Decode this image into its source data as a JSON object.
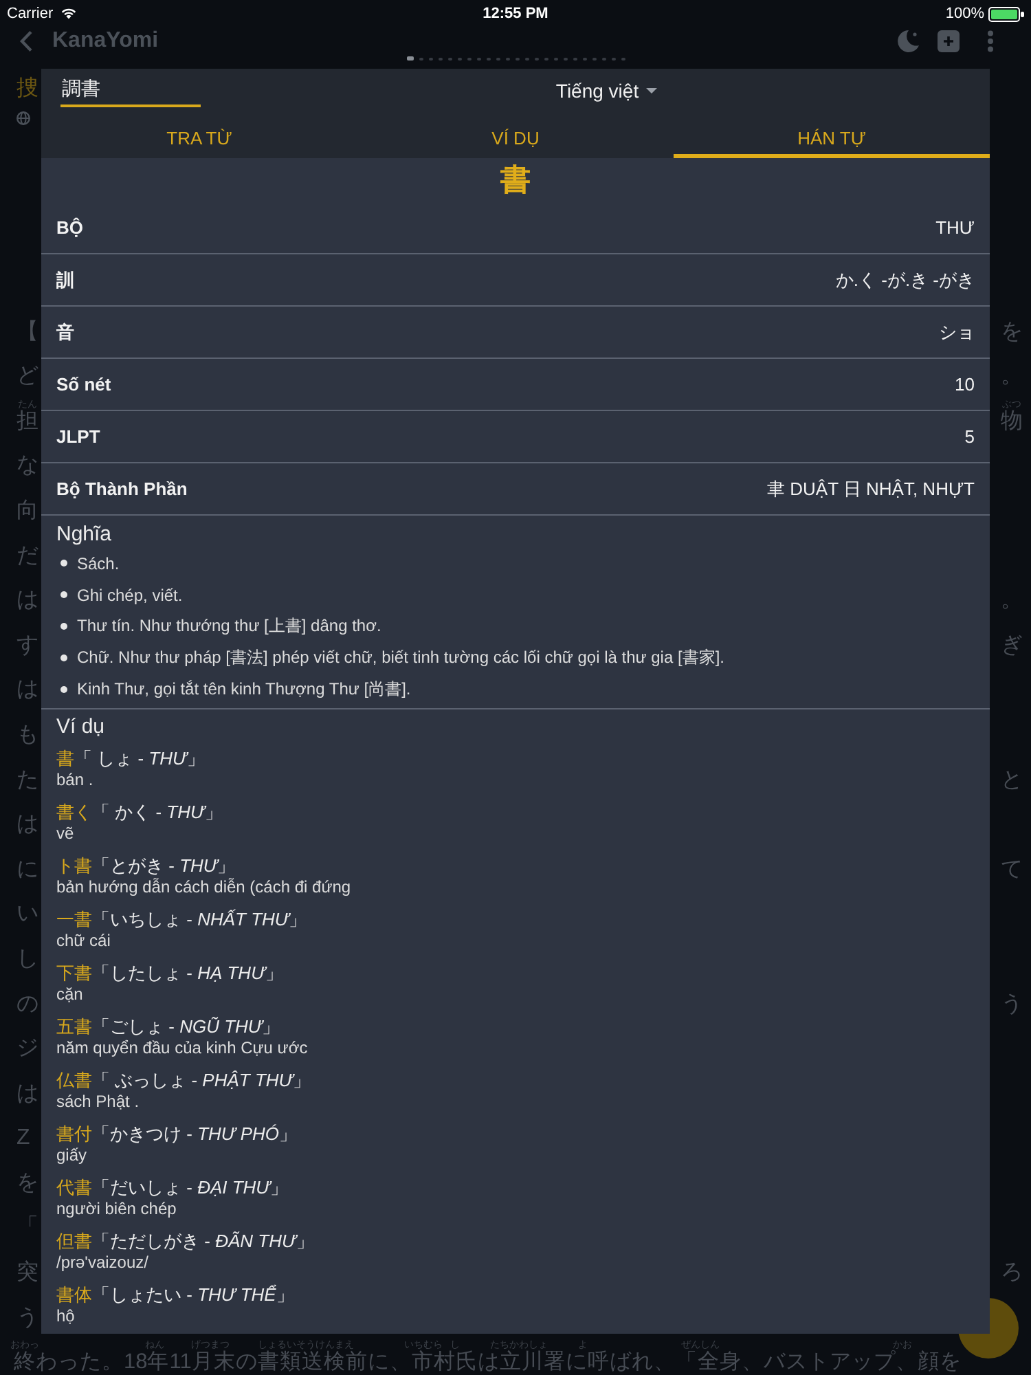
{
  "status_bar": {
    "carrier": "Carrier",
    "time": "12:55 PM",
    "battery": "100%"
  },
  "app_bar": {
    "title": "KanaYomi"
  },
  "page_indicator": {
    "dots": [
      {
        "selected": true
      },
      {
        "selected": false
      },
      {
        "selected": false
      },
      {
        "selected": false
      },
      {
        "selected": false
      },
      {
        "selected": false
      },
      {
        "selected": false
      },
      {
        "selected": false
      },
      {
        "selected": false
      },
      {
        "selected": false
      },
      {
        "selected": false
      },
      {
        "selected": false
      },
      {
        "selected": false
      },
      {
        "selected": false
      },
      {
        "selected": false
      },
      {
        "selected": false
      },
      {
        "selected": false
      },
      {
        "selected": false
      },
      {
        "selected": false
      },
      {
        "selected": false
      },
      {
        "selected": false
      },
      {
        "selected": false
      },
      {
        "selected": false
      }
    ]
  },
  "reader": {
    "heading": "捜",
    "lines": [
      {
        "left": {
          "text": "【"
        },
        "right": {
          "text": "を"
        }
      },
      {
        "left": {
          "text": "ど"
        },
        "right": {
          "text": "。"
        }
      },
      {
        "left": {
          "text": "担",
          "ruby": "たん"
        },
        "right": {
          "text": "物",
          "ruby": "ぶつ"
        }
      },
      {
        "left": {
          "text": "な"
        }
      },
      {
        "left": {
          "text": "向"
        }
      },
      {
        "left": {
          "text": "だ"
        }
      },
      {
        "left": {
          "text": "は"
        },
        "right": {
          "text": "。"
        }
      },
      {
        "left": {
          "text": "す"
        },
        "right": {
          "text": "ぎ"
        }
      },
      {
        "left": {
          "text": "は"
        }
      },
      {
        "left": {
          "text": "も"
        }
      },
      {
        "left": {
          "text": "た"
        },
        "right": {
          "text": "と"
        }
      },
      {
        "left": {
          "text": "は"
        }
      },
      {
        "left": {
          "text": "に"
        },
        "right": {
          "text": "て"
        }
      },
      {
        "left": {
          "text": "い"
        }
      },
      {
        "left": {
          "text": "し"
        }
      },
      {
        "left": {
          "text": "の"
        },
        "right": {
          "text": "う"
        }
      },
      {
        "left": {
          "text": "ジ"
        }
      },
      {
        "left": {
          "text": "は"
        }
      },
      {
        "left": {
          "text": "Z"
        }
      },
      {
        "left": {
          "text": "を"
        }
      },
      {
        "left": {
          "text": "「"
        }
      },
      {
        "left": {
          "text": "突"
        },
        "right": {
          "text": "ろ"
        }
      },
      {
        "left": {
          "text": "う"
        }
      }
    ],
    "last_line": [
      {
        "text": "終",
        "ruby": "おわっ"
      },
      {
        "text": "わった。18"
      },
      {
        "text": "年",
        "ruby": "ねん"
      },
      {
        "text": "11"
      },
      {
        "text": "月末",
        "ruby": "げつまつ"
      },
      {
        "text": "の"
      },
      {
        "text": "書類送検前",
        "ruby": "しょるいそうけんまえ"
      },
      {
        "text": "に、"
      },
      {
        "text": "市村",
        "ruby": "いちむら"
      },
      {
        "text": "氏",
        "ruby": "し"
      },
      {
        "text": "は"
      },
      {
        "text": "立川署",
        "ruby": "たちかわしょ"
      },
      {
        "text": "に"
      },
      {
        "text": "呼",
        "ruby": "よ"
      },
      {
        "text": "ばれ、「"
      },
      {
        "text": "全身",
        "ruby": "ぜんしん"
      },
      {
        "text": "、バストアップ、"
      },
      {
        "text": "顔",
        "ruby": "かお"
      },
      {
        "text": "を"
      }
    ]
  },
  "dialog": {
    "search": {
      "value": "調書"
    },
    "language": {
      "label": "Tiếng việt"
    },
    "tabs": [
      {
        "label": "TRA TỪ",
        "selected": false
      },
      {
        "label": "VÍ DỤ",
        "selected": false
      },
      {
        "label": "HÁN TỰ",
        "selected": true
      }
    ],
    "kanji": "書",
    "details": [
      {
        "label": "BỘ",
        "value": "THƯ"
      },
      {
        "label": "訓",
        "value": "か.く -が.き -がき"
      },
      {
        "label": "音",
        "value": "ショ"
      },
      {
        "label": "Số nét",
        "value": "10"
      },
      {
        "label": "JLPT",
        "value": "5"
      },
      {
        "label": "Bộ Thành Phần",
        "value": "聿 DUẬT 日 NHẬT, NHỰT"
      }
    ],
    "meaning": {
      "title": "Nghĩa",
      "items": [
        "Sách.",
        "Ghi chép, viết.",
        "Thư tín. Như thướng thư [上書] dâng thơ.",
        "Chữ. Như thư pháp [書法] phép viết chữ, biết tinh tường các lối chữ gọi là thư gia [書家].",
        "Kinh Thư, gọi tắt tên kinh Thượng Thư [尚書]."
      ]
    },
    "examples": {
      "title": "Ví dụ",
      "items": [
        {
          "word": "書",
          "reading": "「 しょ - *THƯ*」",
          "meaning": "bán ."
        },
        {
          "word": "書く",
          "reading": "「 かく - *THƯ*」",
          "meaning": "vẽ"
        },
        {
          "word": "ト書",
          "reading": "「とがき - *THƯ*」",
          "meaning": "bản hướng dẫn cách diễn (cách đi đứng"
        },
        {
          "word": "一書",
          "reading": "「いちしょ - *NHẤT THƯ*」",
          "meaning": "chữ cái"
        },
        {
          "word": "下書",
          "reading": "「したしょ - *HẠ THƯ*」",
          "meaning": "cặn"
        },
        {
          "word": "五書",
          "reading": "「ごしょ - *NGŨ THƯ*」",
          "meaning": "năm quyển đầu của kinh Cựu ước"
        },
        {
          "word": "仏書",
          "reading": "「 ぶっしょ - *PHẬT THƯ*」",
          "meaning": "sách Phật ."
        },
        {
          "word": "書付",
          "reading": "「かきつけ - *THƯ PHÓ*」",
          "meaning": "giấy"
        },
        {
          "word": "代書",
          "reading": "「だいしょ - *ĐẠI THƯ*」",
          "meaning": "người biên chép"
        },
        {
          "word": "但書",
          "reading": "「ただしがき - *ĐÃN THƯ*」",
          "meaning": "/prə'vaizouz/"
        },
        {
          "word": "書体",
          "reading": "「しょたい - *THƯ THỂ*」",
          "meaning": "hộ"
        }
      ]
    }
  }
}
